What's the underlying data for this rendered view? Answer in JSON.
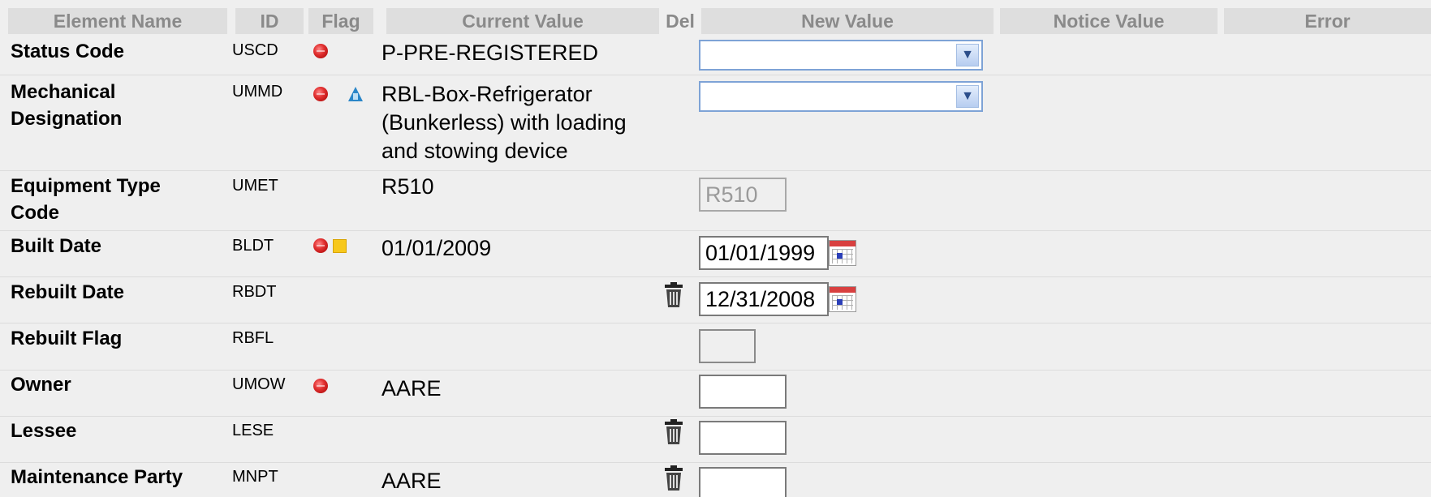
{
  "headers": {
    "element_name": "Element Name",
    "id": "ID",
    "flag": "Flag",
    "current_value": "Current Value",
    "del": "Del",
    "new_value": "New Value",
    "notice_value": "Notice Value",
    "error": "Error"
  },
  "rows": [
    {
      "name": "Status Code",
      "id": "USCD",
      "flags": [
        "red-dot-icon"
      ],
      "current": "P-PRE-REGISTERED",
      "del": false,
      "new_value_type": "select",
      "new_value": ""
    },
    {
      "name": "Mechanical Designation",
      "id": "UMMD",
      "flags": [
        "red-dot-icon",
        "blue-triangle-icon"
      ],
      "current": "RBL-Box-Refrigerator (Bunkerless) with loading and stowing device",
      "del": false,
      "new_value_type": "select",
      "new_value": ""
    },
    {
      "name": "Equipment Type Code",
      "id": "UMET",
      "flags": [],
      "current": "R510",
      "del": false,
      "new_value_type": "text-disabled",
      "new_value": "R510"
    },
    {
      "name": "Built Date",
      "id": "BLDT",
      "flags": [
        "red-dot-icon",
        "yellow-square-icon"
      ],
      "current": "01/01/2009",
      "del": false,
      "new_value_type": "date",
      "new_value": "01/01/1999"
    },
    {
      "name": "Rebuilt Date",
      "id": "RBDT",
      "flags": [],
      "current": "",
      "del": true,
      "new_value_type": "date",
      "new_value": "12/31/2008"
    },
    {
      "name": "Rebuilt Flag",
      "id": "RBFL",
      "flags": [],
      "current": "",
      "del": false,
      "new_value_type": "text-small",
      "new_value": ""
    },
    {
      "name": "Owner",
      "id": "UMOW",
      "flags": [
        "red-dot-icon"
      ],
      "current": "AARE",
      "del": false,
      "new_value_type": "text",
      "new_value": ""
    },
    {
      "name": "Lessee",
      "id": "LESE",
      "flags": [],
      "current": "",
      "del": true,
      "new_value_type": "text",
      "new_value": ""
    },
    {
      "name": "Maintenance Party",
      "id": "MNPT",
      "flags": [],
      "current": "AARE",
      "del": true,
      "new_value_type": "text",
      "new_value": ""
    }
  ],
  "colors": {
    "header_bg": "#dedede",
    "header_text": "#8a8a8a",
    "row_bg": "#efefef",
    "flag_red": "#e23232",
    "flag_yellow": "#f7c81c",
    "flag_blue": "#2a86c8"
  }
}
